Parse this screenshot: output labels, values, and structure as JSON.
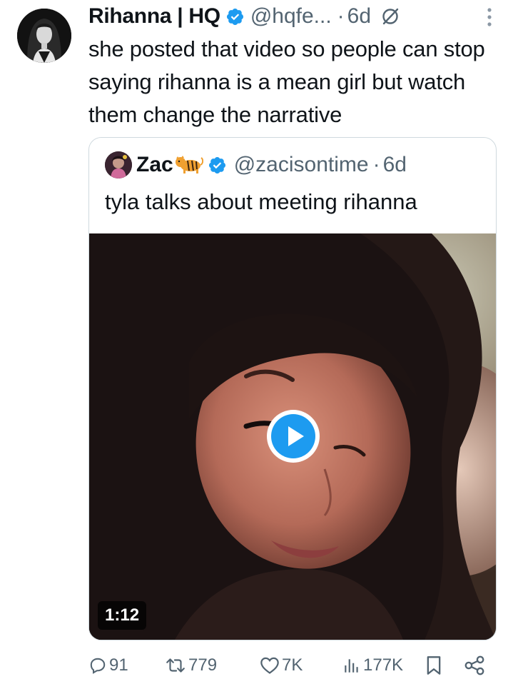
{
  "tweet": {
    "author": {
      "display_name": "Rihanna | HQ",
      "handle": "@hqfe...",
      "verified": true,
      "avatar_icon": "rihanna-avatar"
    },
    "separator": "·",
    "time": "6d",
    "text": "she posted that video so people can stop saying rihanna is a mean girl but watch them change the narrative"
  },
  "quote": {
    "author": {
      "display_name": "Zac",
      "emoji_icon": "tiger-icon",
      "handle": "@zacisontime",
      "verified": true
    },
    "separator": "·",
    "time": "6d",
    "text": "tyla talks about meeting rihanna",
    "video": {
      "duration": "1:12"
    }
  },
  "actions": {
    "replies": "91",
    "reposts": "779",
    "likes": "7K",
    "views": "177K"
  },
  "colors": {
    "text_primary": "#0f1419",
    "text_secondary": "#536471",
    "verified_blue": "#1d9bf0",
    "border": "#cfd9de"
  }
}
